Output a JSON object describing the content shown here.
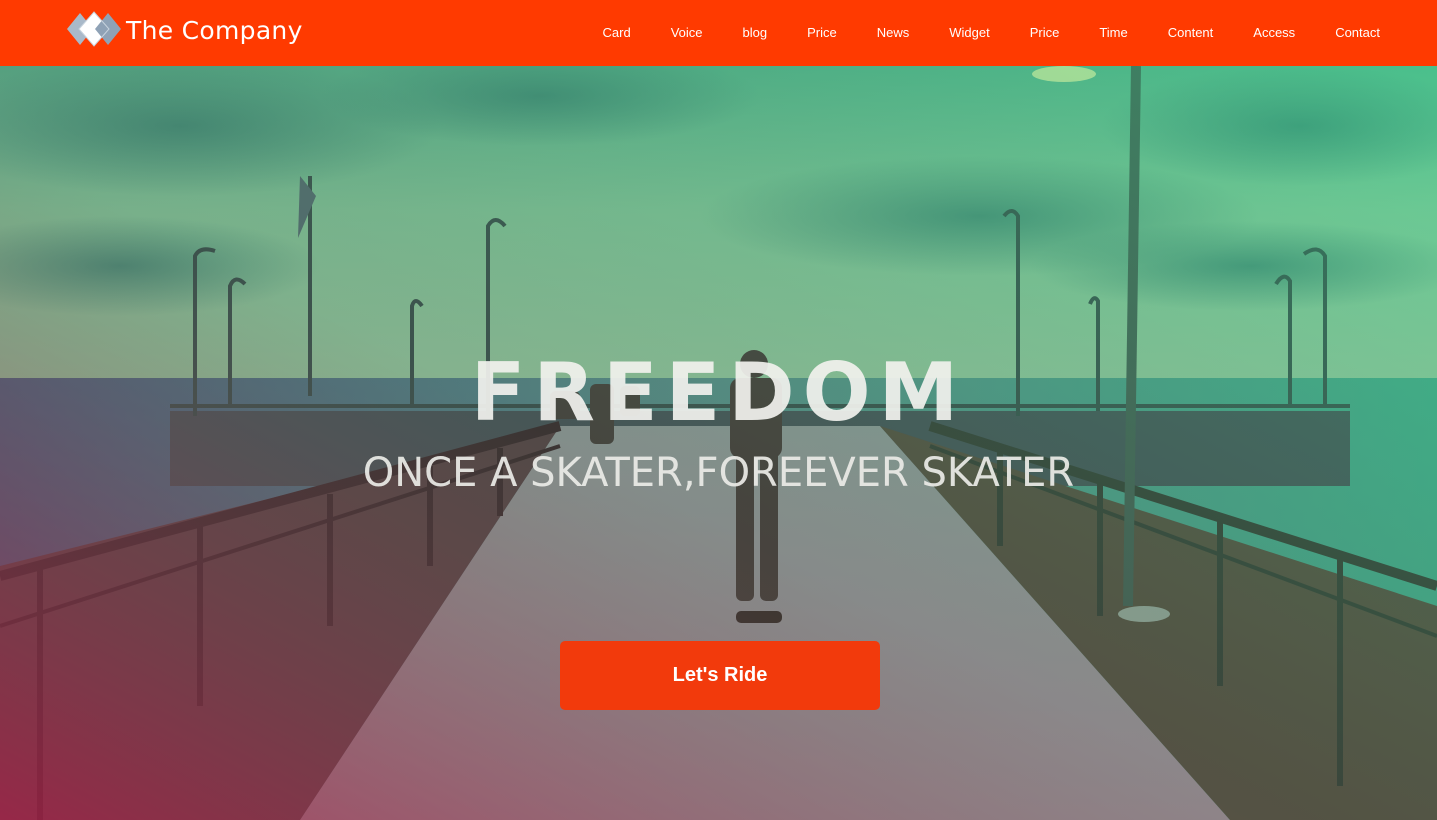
{
  "brand": {
    "name": "The Company",
    "logo_icon": "diamond-logo-icon",
    "header_color": "#ff3a00"
  },
  "nav": {
    "items": [
      {
        "label": "Card"
      },
      {
        "label": "Voice"
      },
      {
        "label": "blog"
      },
      {
        "label": "Price"
      },
      {
        "label": "News"
      },
      {
        "label": "Widget"
      },
      {
        "label": "Price"
      },
      {
        "label": "Time"
      },
      {
        "label": "Content"
      },
      {
        "label": "Access"
      },
      {
        "label": "Contact"
      }
    ]
  },
  "hero": {
    "title": "FREEDOM",
    "subtitle": "ONCE A SKATER,FOREEVER SKATER",
    "cta_label": "Let's Ride",
    "cta_color": "#f23a0c",
    "overlay_colors": [
      "#6fe08a",
      "#2a9a8a",
      "#b0204a"
    ]
  }
}
